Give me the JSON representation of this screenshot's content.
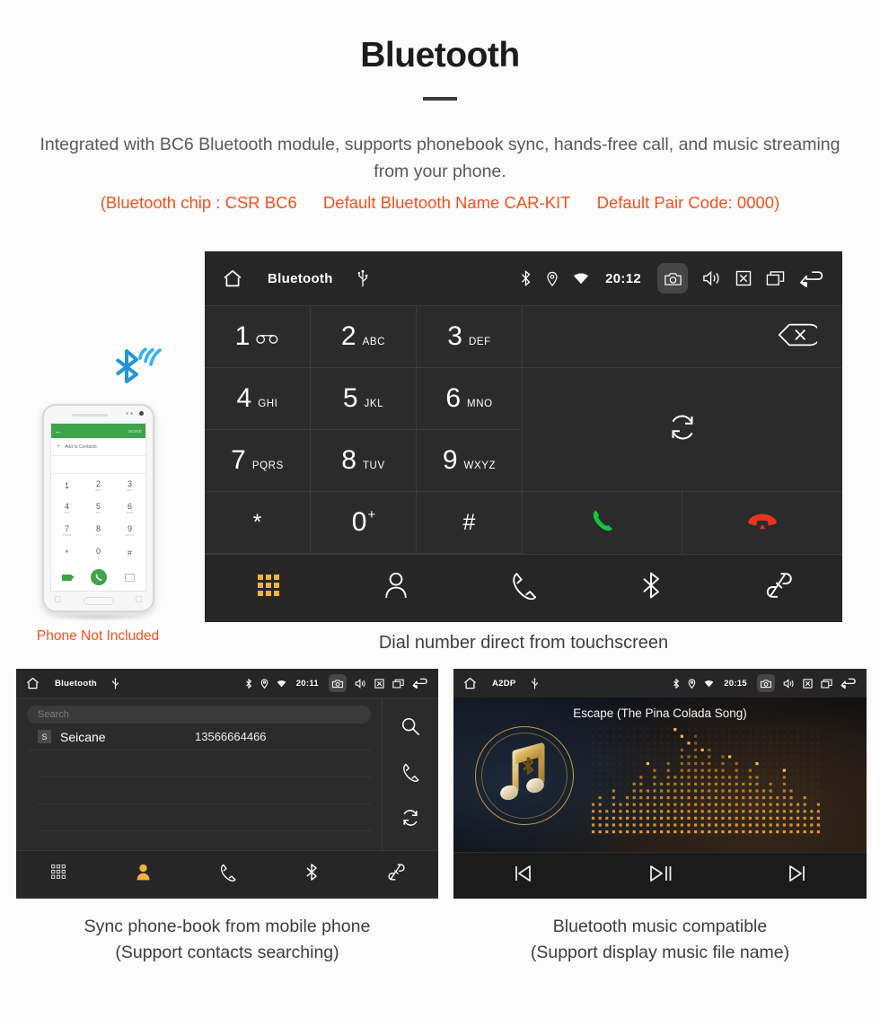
{
  "header": {
    "title": "Bluetooth",
    "description": "Integrated with BC6 Bluetooth module, supports phonebook sync, hands-free call, and music streaming from your phone.",
    "accent_open": "(Bluetooth chip : CSR BC6",
    "accent_mid": "Default Bluetooth Name CAR-KIT",
    "accent_close": "Default Pair Code: 0000)",
    "accent_color": "#f4511e"
  },
  "dialer": {
    "statusbar": {
      "title": "Bluetooth",
      "time": "20:12",
      "icons": [
        "home-icon",
        "usb-icon",
        "bluetooth-icon",
        "location-icon",
        "wifi-icon",
        "camera-icon",
        "volume-icon",
        "close-icon",
        "recents-icon",
        "back-icon"
      ]
    },
    "keys": [
      {
        "digit": "1",
        "letters": "",
        "icon": "voicemail-icon"
      },
      {
        "digit": "2",
        "letters": "ABC",
        "icon": ""
      },
      {
        "digit": "3",
        "letters": "DEF",
        "icon": ""
      },
      {
        "digit": "4",
        "letters": "GHI",
        "icon": ""
      },
      {
        "digit": "5",
        "letters": "JKL",
        "icon": ""
      },
      {
        "digit": "6",
        "letters": "MNO",
        "icon": ""
      },
      {
        "digit": "7",
        "letters": "PQRS",
        "icon": ""
      },
      {
        "digit": "8",
        "letters": "TUV",
        "icon": ""
      },
      {
        "digit": "9",
        "letters": "WXYZ",
        "icon": ""
      },
      {
        "digit": "*",
        "letters": "",
        "icon": ""
      },
      {
        "digit": "0",
        "letters": "",
        "icon": "plus-superscript"
      },
      {
        "digit": "#",
        "letters": "",
        "icon": ""
      }
    ],
    "side_actions": [
      "backspace-icon",
      "sync-icon",
      "call-icon",
      "hangup-icon"
    ],
    "call_color": "#12c43a",
    "hangup_color": "#e8341a",
    "nav": [
      {
        "name": "keypad",
        "icon": "keypad-icon",
        "active": true
      },
      {
        "name": "contacts",
        "icon": "contact-icon",
        "active": false
      },
      {
        "name": "calls",
        "icon": "handset-icon",
        "active": false
      },
      {
        "name": "bluetooth",
        "icon": "bluetooth-icon",
        "active": false
      },
      {
        "name": "link",
        "icon": "link-icon",
        "active": false
      }
    ],
    "active_color": "#f2b33d",
    "caption": "Dial number direct from touchscreen"
  },
  "phone_mock": {
    "bar_more": "MORE",
    "add_contacts": "Add to Contacts",
    "keys": [
      {
        "digit": "1",
        "sub": ""
      },
      {
        "digit": "2",
        "sub": "ABC"
      },
      {
        "digit": "3",
        "sub": "DEF"
      },
      {
        "digit": "4",
        "sub": "GHI"
      },
      {
        "digit": "5",
        "sub": "JKL"
      },
      {
        "digit": "6",
        "sub": "MNO"
      },
      {
        "digit": "7",
        "sub": "PQRS"
      },
      {
        "digit": "8",
        "sub": "TUV"
      },
      {
        "digit": "9",
        "sub": "WXYZ"
      },
      {
        "digit": "*",
        "sub": ""
      },
      {
        "digit": "0",
        "sub": "+"
      },
      {
        "digit": "#",
        "sub": ""
      }
    ],
    "caption": "Phone Not Included",
    "caption_color": "#f4511e",
    "signal_color": "#2196d8"
  },
  "phonebook": {
    "statusbar": {
      "title": "Bluetooth",
      "time": "20:11"
    },
    "search_placeholder": "Search",
    "contacts": [
      {
        "badge": "S",
        "name": "Seicane",
        "number": "13566664466"
      }
    ],
    "side_actions": [
      "search-icon",
      "handset-icon",
      "sync-icon"
    ],
    "nav": [
      {
        "name": "keypad",
        "icon": "keypad-icon",
        "active": false
      },
      {
        "name": "contacts",
        "icon": "contact-icon",
        "active": true
      },
      {
        "name": "calls",
        "icon": "handset-icon",
        "active": false
      },
      {
        "name": "bluetooth",
        "icon": "bluetooth-icon",
        "active": false
      },
      {
        "name": "link",
        "icon": "link-icon",
        "active": false
      }
    ],
    "caption_line1": "Sync phone-book from mobile phone",
    "caption_line2": "(Support contacts searching)"
  },
  "music": {
    "statusbar": {
      "title": "A2DP",
      "time": "20:15"
    },
    "song_title": "Escape (The Pina Colada Song)",
    "controls": [
      "previous-icon",
      "play-pause-icon",
      "next-icon"
    ],
    "gold_color": "#c79a3e",
    "caption_line1": "Bluetooth music compatible",
    "caption_line2": "(Support display music file name)"
  }
}
